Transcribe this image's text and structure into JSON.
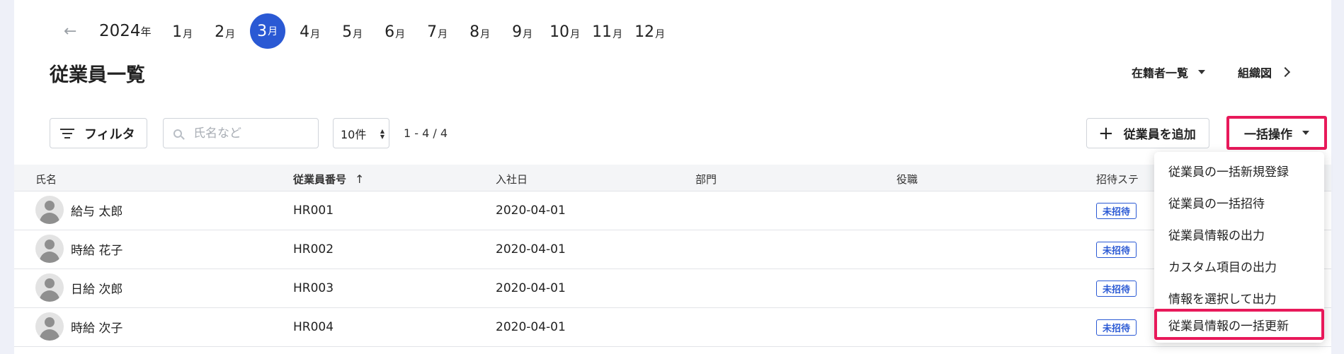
{
  "months_nav": {
    "back_icon": "arrow-left-icon",
    "year": "2024",
    "year_suffix": "年",
    "month_suffix": "月",
    "months": [
      "1",
      "2",
      "3",
      "4",
      "5",
      "6",
      "7",
      "8",
      "9",
      "10",
      "11",
      "12"
    ],
    "active_month": "3",
    "active_color": "#2a59d4"
  },
  "page": {
    "title": "従業員一覧",
    "roster_label": "在籍者一覧",
    "org_chart_label": "組織図"
  },
  "toolbar": {
    "filter_label": "フィルタ",
    "search_placeholder": "氏名など",
    "page_size": "10件",
    "range": "1 - 4 / 4",
    "add_label": "従業員を追加",
    "bulk_label": "一括操作",
    "highlight_color": "#e8195a"
  },
  "table": {
    "headers": {
      "name": "氏名",
      "number": "従業員番号",
      "joined": "入社日",
      "department": "部門",
      "position": "役職",
      "invite_status": "招待ステ"
    },
    "rows": [
      {
        "name": "給与 太郎",
        "number": "HR001",
        "joined": "2020-04-01",
        "status": "未招待"
      },
      {
        "name": "時給 花子",
        "number": "HR002",
        "joined": "2020-04-01",
        "status": "未招待"
      },
      {
        "name": "日給 次郎",
        "number": "HR003",
        "joined": "2020-04-01",
        "status": "未招待"
      },
      {
        "name": "時給 次子",
        "number": "HR004",
        "joined": "2020-04-01",
        "status": "未招待"
      }
    ]
  },
  "bulk_menu": {
    "items": [
      "従業員の一括新規登録",
      "従業員の一括招待",
      "従業員情報の出力",
      "カスタム項目の出力",
      "情報を選択して出力",
      "従業員情報の一括更新"
    ]
  }
}
